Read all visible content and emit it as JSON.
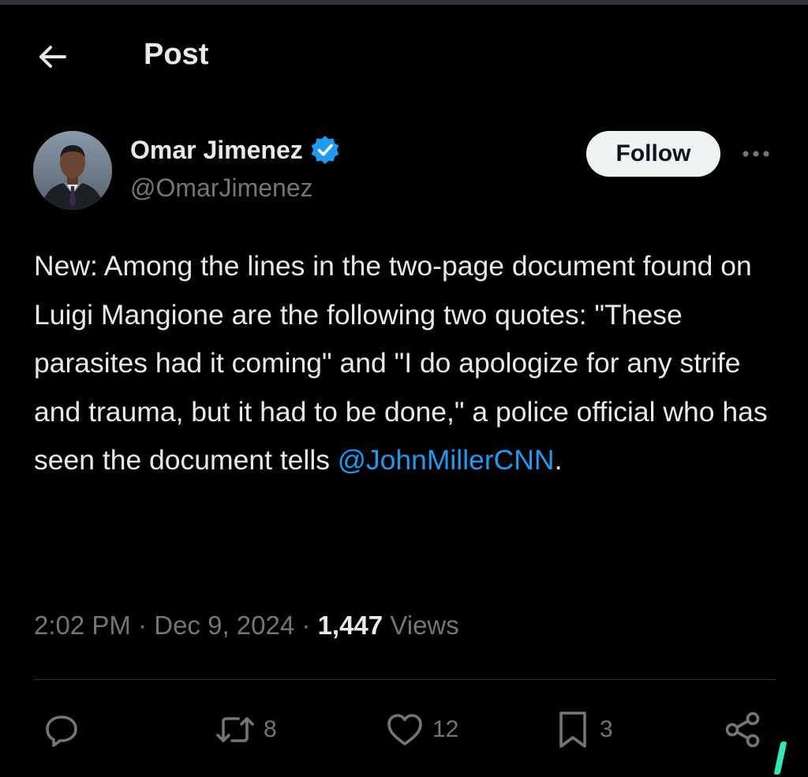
{
  "header": {
    "title": "Post"
  },
  "author": {
    "name": "Omar Jimenez",
    "handle": "@OmarJimenez",
    "verified": true
  },
  "follow_button": {
    "label": "Follow"
  },
  "tweet": {
    "text": "New: Among the lines in the two-page document found on Luigi Mangione are the following two quotes: \"These parasites had it coming\" and \"I do apologize for any strife and trauma, but it had to be done,\" a police official who has seen the document tells ",
    "mention": "@JohnMillerCNN",
    "trailing": "."
  },
  "meta": {
    "time": "2:02 PM",
    "separator": "·",
    "date": "Dec 9, 2024",
    "views_count": "1,447",
    "views_label": "Views"
  },
  "actions": {
    "retweets": "8",
    "likes": "12",
    "bookmarks": "3"
  },
  "colors": {
    "background": "#000000",
    "text": "#e7e9ea",
    "secondary": "#71767b",
    "accent": "#1d9bf0",
    "verified": "#1d9bf0"
  }
}
